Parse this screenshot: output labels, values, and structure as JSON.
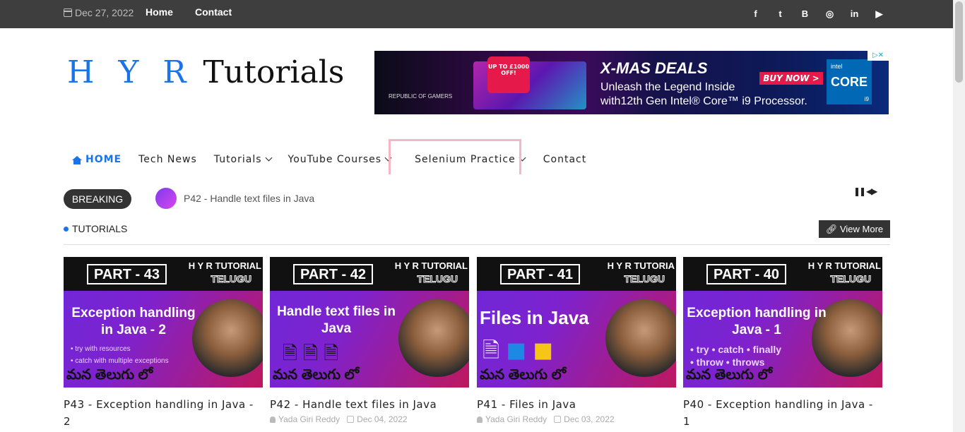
{
  "topbar": {
    "date": "Dec 27, 2022",
    "links": [
      "Home",
      "Contact"
    ],
    "socials": [
      "facebook-icon",
      "twitter-icon",
      "blogger-icon",
      "instagram-icon",
      "linkedin-icon",
      "youtube-icon"
    ]
  },
  "logo": {
    "part1": "H Y R",
    "part2": " Tutorials"
  },
  "ad": {
    "rog": "REPUBLIC OF GAMERS",
    "badge": "UP TO £1000 OFF!",
    "headline": "X-MAS DEALS",
    "buy": "BUY NOW >",
    "line1": "Unleash the Legend Inside",
    "line2": "with12th Gen Intel® Core™ i9 Processor.",
    "intel_brand": "intel",
    "intel_core": "CORE",
    "intel_tier": "i9",
    "adchoices": "▷✕"
  },
  "nav": {
    "home": "HOME",
    "items": [
      "Tech News",
      "Tutorials",
      "YouTube Courses",
      "Selenium Practice",
      "Contact"
    ]
  },
  "breaking": {
    "label": "BREAKING",
    "text": "P42 - Handle text files in Java"
  },
  "section": {
    "title": "TUTORIALS",
    "view_more": "View More"
  },
  "cards": [
    {
      "part": "PART - 43",
      "brand": "H Y R TUTORIAL",
      "brand_sub": "TELUGU",
      "heading": "Exception handling in Java - 2",
      "bullets": [
        "• try with resources",
        "• catch with multiple exceptions"
      ],
      "telugu": "మన తెలుగు లో",
      "title": "P43 - Exception handling in Java - 2",
      "author": "",
      "date": ""
    },
    {
      "part": "PART - 42",
      "brand": "H Y R TUTORIAL",
      "brand_sub": "TELUGU",
      "heading": "Handle text files in Java",
      "bullets": [],
      "telugu": "మన తెలుగు లో",
      "title": "P42 - Handle text files in Java",
      "author": "Yada Giri Reddy",
      "date": "Dec 04, 2022"
    },
    {
      "part": "PART - 41",
      "brand": "H Y R TUTORIA",
      "brand_sub": "TELUGU",
      "heading": "Files in Java",
      "bullets": [],
      "telugu": "మన తెలుగు లో",
      "title": "P41 - Files in Java",
      "author": "Yada Giri Reddy",
      "date": "Dec 03, 2022"
    },
    {
      "part": "PART - 40",
      "brand": "H Y R TUTORIAL",
      "brand_sub": "TELUGU",
      "heading": "Exception handling in Java - 1",
      "bullets": [
        "• try   • catch   • finally",
        "• throw   • throws"
      ],
      "telugu": "మన తెలుగు లో",
      "title": "P40 - Exception handling in Java - 1",
      "author": "",
      "date": ""
    }
  ],
  "colors": {
    "accent": "#1a73e8",
    "topbar": "#3e3e3e",
    "highlight": "#f5b7c8"
  }
}
